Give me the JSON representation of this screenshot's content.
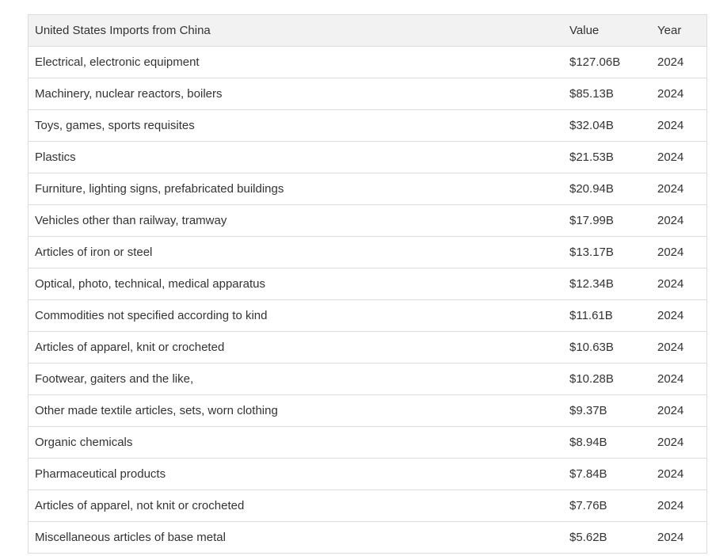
{
  "table": {
    "headers": [
      "United States Imports from China",
      "Value",
      "Year"
    ],
    "rows": [
      [
        "Electrical, electronic equipment",
        "$127.06B",
        "2024"
      ],
      [
        "Machinery, nuclear reactors, boilers",
        "$85.13B",
        "2024"
      ],
      [
        "Toys, games, sports requisites",
        "$32.04B",
        "2024"
      ],
      [
        "Plastics",
        "$21.53B",
        "2024"
      ],
      [
        "Furniture, lighting signs, prefabricated buildings",
        "$20.94B",
        "2024"
      ],
      [
        "Vehicles other than railway, tramway",
        "$17.99B",
        "2024"
      ],
      [
        "Articles of iron or steel",
        "$13.17B",
        "2024"
      ],
      [
        "Optical, photo, technical, medical apparatus",
        "$12.34B",
        "2024"
      ],
      [
        "Commodities not specified according to kind",
        "$11.61B",
        "2024"
      ],
      [
        "Articles of apparel, knit or crocheted",
        "$10.63B",
        "2024"
      ],
      [
        "Footwear, gaiters and the like,",
        "$10.28B",
        "2024"
      ],
      [
        "Other made textile articles, sets, worn clothing",
        "$9.37B",
        "2024"
      ],
      [
        "Organic chemicals",
        "$8.94B",
        "2024"
      ],
      [
        "Pharmaceutical products",
        "$7.84B",
        "2024"
      ],
      [
        "Articles of apparel, not knit or crocheted",
        "$7.76B",
        "2024"
      ],
      [
        "Miscellaneous articles of base metal",
        "$5.62B",
        "2024"
      ]
    ]
  },
  "colors": {
    "header_bg": "#f2f2f2",
    "border": "#dcdcdc",
    "text": "#333333"
  }
}
